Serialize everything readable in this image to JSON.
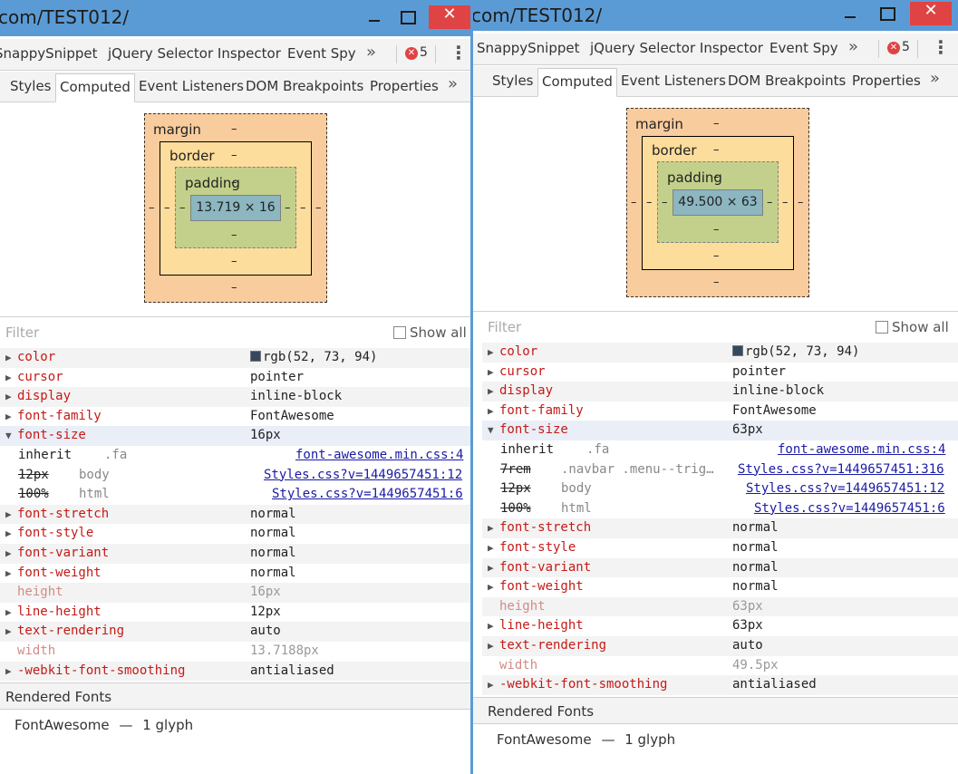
{
  "colors": {
    "titlebar": "#5b9bd5",
    "close": "#e04343",
    "prop_name": "#c41a16",
    "link": "#1a1aa6",
    "swatch": "#34495e"
  },
  "icons": {
    "close": "close-icon",
    "minimize": "minimize-icon",
    "maximize": "maximize-icon",
    "error": "error-icon",
    "more": "chevron-double-right-icon",
    "menu": "kebab-menu-icon",
    "expand": "expand-triangle-icon"
  },
  "window_left": {
    "title": "com/TEST012/",
    "toolbar": {
      "tab1": "SnappySnippet",
      "tab2": "jQuery Selector Inspector",
      "tab3": "Event Spy",
      "more": "»",
      "errors": "5"
    },
    "subtabs": {
      "styles": "Styles",
      "computed": "Computed",
      "event_listeners": "Event Listeners",
      "dom_breakpoints": "DOM Breakpoints",
      "properties": "Properties",
      "more": "»"
    },
    "boxmodel": {
      "margin": "margin",
      "border": "border",
      "padding": "padding",
      "content": "13.719 × 16",
      "dash": "–"
    },
    "filter": {
      "placeholder": "Filter",
      "show_all": "Show all"
    },
    "props": [
      {
        "name": "color",
        "value": "rgb(52, 73, 94)"
      },
      {
        "name": "cursor",
        "value": "pointer"
      },
      {
        "name": "display",
        "value": "inline-block"
      },
      {
        "name": "font-family",
        "value": "FontAwesome"
      },
      {
        "name": "font-size",
        "value": "16px"
      },
      {
        "name": "font-stretch",
        "value": "normal"
      },
      {
        "name": "font-style",
        "value": "normal"
      },
      {
        "name": "font-variant",
        "value": "normal"
      },
      {
        "name": "font-weight",
        "value": "normal"
      },
      {
        "name": "height",
        "value": "16px"
      },
      {
        "name": "line-height",
        "value": "12px"
      },
      {
        "name": "text-rendering",
        "value": "auto"
      },
      {
        "name": "width",
        "value": "13.7188px"
      },
      {
        "name": "-webkit-font-smoothing",
        "value": "antialiased"
      }
    ],
    "traces": [
      {
        "value": "inherit",
        "selector": ".fa",
        "source": "font-awesome.min.css:4"
      },
      {
        "value": "12px",
        "selector": "body",
        "source": "Styles.css?v=1449657451:12"
      },
      {
        "value": "100%",
        "selector": "html",
        "source": "Styles.css?v=1449657451:6"
      }
    ],
    "rendered_fonts": {
      "header": "Rendered Fonts",
      "font": "FontAwesome",
      "sep": "—",
      "glyphs": "1 glyph"
    }
  },
  "window_right": {
    "title": "com/TEST012/",
    "toolbar": {
      "tab1": "SnappySnippet",
      "tab2": "jQuery Selector Inspector",
      "tab3": "Event Spy",
      "more": "»",
      "errors": "5"
    },
    "subtabs": {
      "styles": "Styles",
      "computed": "Computed",
      "event_listeners": "Event Listeners",
      "dom_breakpoints": "DOM Breakpoints",
      "properties": "Properties",
      "more": "»"
    },
    "boxmodel": {
      "margin": "margin",
      "border": "border",
      "padding": "padding",
      "content": "49.500 × 63",
      "dash": "–"
    },
    "filter": {
      "placeholder": "Filter",
      "show_all": "Show all"
    },
    "props": [
      {
        "name": "color",
        "value": "rgb(52, 73, 94)"
      },
      {
        "name": "cursor",
        "value": "pointer"
      },
      {
        "name": "display",
        "value": "inline-block"
      },
      {
        "name": "font-family",
        "value": "FontAwesome"
      },
      {
        "name": "font-size",
        "value": "63px"
      },
      {
        "name": "font-stretch",
        "value": "normal"
      },
      {
        "name": "font-style",
        "value": "normal"
      },
      {
        "name": "font-variant",
        "value": "normal"
      },
      {
        "name": "font-weight",
        "value": "normal"
      },
      {
        "name": "height",
        "value": "63px"
      },
      {
        "name": "line-height",
        "value": "63px"
      },
      {
        "name": "text-rendering",
        "value": "auto"
      },
      {
        "name": "width",
        "value": "49.5px"
      },
      {
        "name": "-webkit-font-smoothing",
        "value": "antialiased"
      }
    ],
    "traces": [
      {
        "value": "inherit",
        "selector": ".fa",
        "source": "font-awesome.min.css:4"
      },
      {
        "value": "7rem",
        "selector": ".navbar .menu--trig…",
        "source": "Styles.css?v=1449657451:316"
      },
      {
        "value": "12px",
        "selector": "body",
        "source": "Styles.css?v=1449657451:12"
      },
      {
        "value": "100%",
        "selector": "html",
        "source": "Styles.css?v=1449657451:6"
      }
    ],
    "rendered_fonts": {
      "header": "Rendered Fonts",
      "font": "FontAwesome",
      "sep": "—",
      "glyphs": "1 glyph"
    }
  }
}
